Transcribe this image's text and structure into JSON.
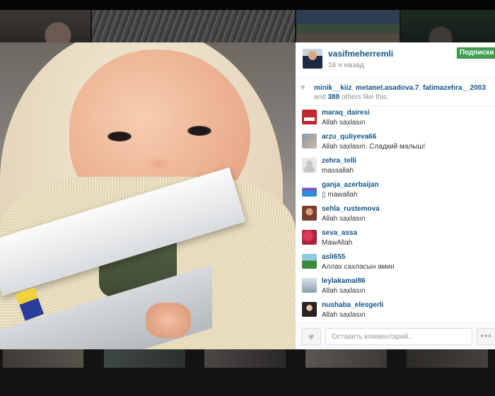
{
  "post": {
    "username": "vasifmeherremli",
    "time": "16 ч назад",
    "follow_label": "Подписки"
  },
  "likes": {
    "users": [
      "minik__kiiz",
      "metanet.asadova.7",
      "fatimazehra__2003"
    ],
    "separator": ", ",
    "and_text": " and ",
    "others_count": "388",
    "others_text": " others like this."
  },
  "comments": [
    {
      "user": "maraq_dairesi",
      "text": "Allah saxlasın",
      "avatar": "avatar-red-logo"
    },
    {
      "user": "arzu_quliyeva66",
      "text": "Allah saxlasın. Сладкий малыш!",
      "avatar": "avatar-couple-photo"
    },
    {
      "user": "zehra_telli",
      "text": "massallah",
      "avatar": "avatar-default-silhouette"
    },
    {
      "user": "ganja_azerbaijan",
      "text": "▯ mawallah",
      "avatar": "avatar-flag"
    },
    {
      "user": "sehla_rustemova",
      "text": "Allah saxlasın",
      "avatar": "avatar-woman-photo"
    },
    {
      "user": "seva_assa",
      "text": "MawAllah",
      "avatar": "avatar-flowers"
    },
    {
      "user": "asli655",
      "text": "Аллах сахласын амин",
      "avatar": "avatar-landscape"
    },
    {
      "user": "leylakamal86",
      "text": "Allah saxlasın",
      "avatar": "avatar-woman-photo"
    },
    {
      "user": "nushaba_elesgerli",
      "text": "Allah saxlasın",
      "avatar": "avatar-woman-photo"
    }
  ],
  "footer": {
    "comment_placeholder": "Оставить комментарий...",
    "like_icon": "heart-icon",
    "more_label": "•••"
  },
  "colors": {
    "link": "#125688",
    "follow_green": "#3f9e54",
    "muted": "#a5a7aa"
  }
}
